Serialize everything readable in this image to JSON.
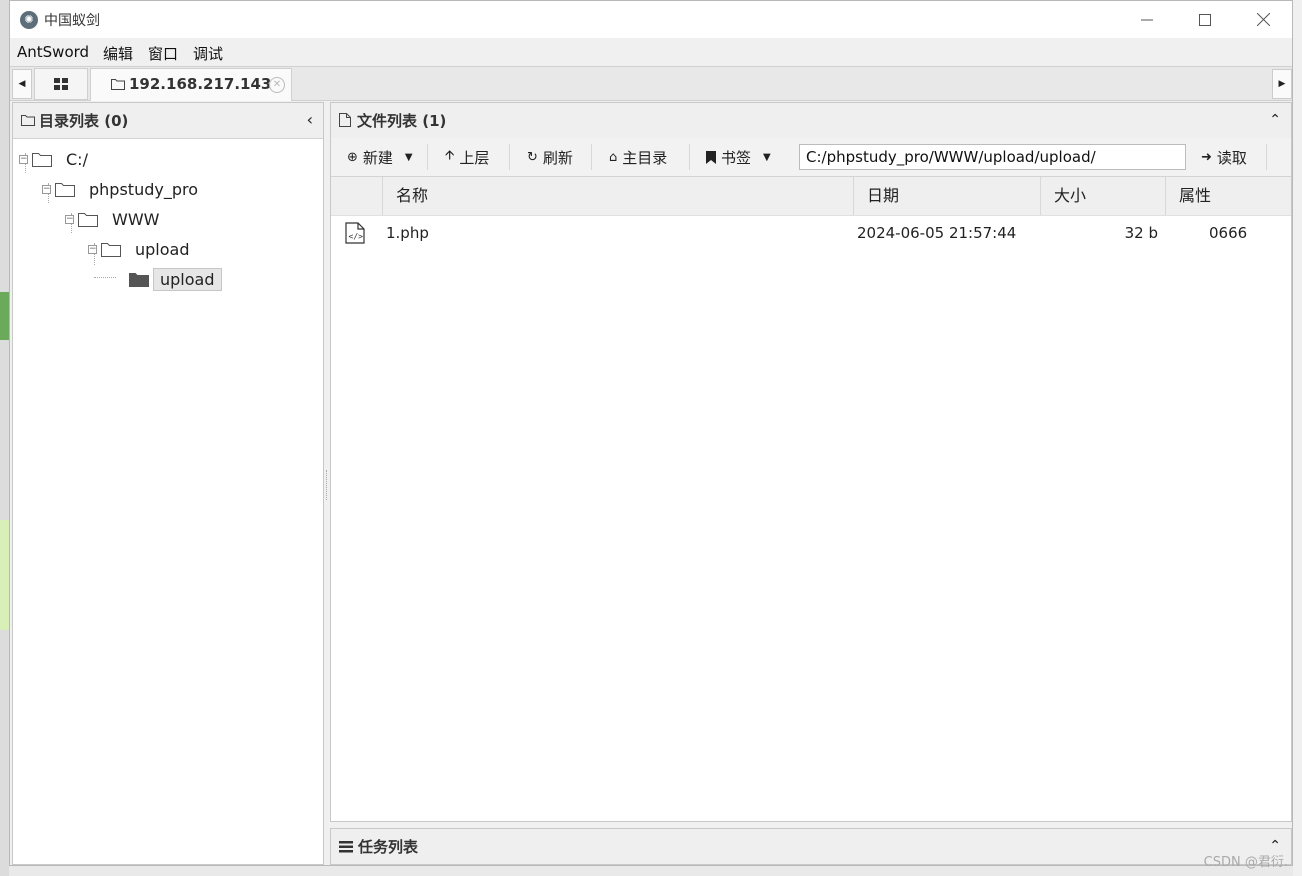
{
  "window": {
    "title": "中国蚁剑",
    "app_icon": "antsword-logo-icon",
    "controls": [
      "minimize-icon",
      "maximize-icon",
      "close-icon"
    ]
  },
  "menu": [
    {
      "label": "AntSword"
    },
    {
      "label": "编辑"
    },
    {
      "label": "窗口"
    },
    {
      "label": "调试"
    }
  ],
  "tabs": {
    "active_label": "192.168.217.143"
  },
  "left_panel": {
    "title": "目录列表 (0)",
    "tree": [
      {
        "label": "C:/",
        "depth": 0
      },
      {
        "label": "phpstudy_pro",
        "depth": 1
      },
      {
        "label": "WWW",
        "depth": 2
      },
      {
        "label": "upload",
        "depth": 3
      },
      {
        "label": "upload",
        "depth": 4,
        "selected": true
      }
    ]
  },
  "right_panel": {
    "title": "文件列表 (1)",
    "toolbar": {
      "new": "新建",
      "up": "上层",
      "refresh": "刷新",
      "home": "主目录",
      "bookmark": "书签",
      "path": "C:/phpstudy_pro/WWW/upload/upload/",
      "read": "读取"
    },
    "columns": {
      "name": "名称",
      "date": "日期",
      "size": "大小",
      "attr": "属性"
    },
    "files": [
      {
        "name": "1.php",
        "date": "2024-06-05 21:57:44",
        "size": "32 b",
        "attr": "0666",
        "icon": "php-file-icon"
      }
    ]
  },
  "bottom_panel": {
    "title": "任务列表"
  },
  "watermark": "CSDN @君衍."
}
